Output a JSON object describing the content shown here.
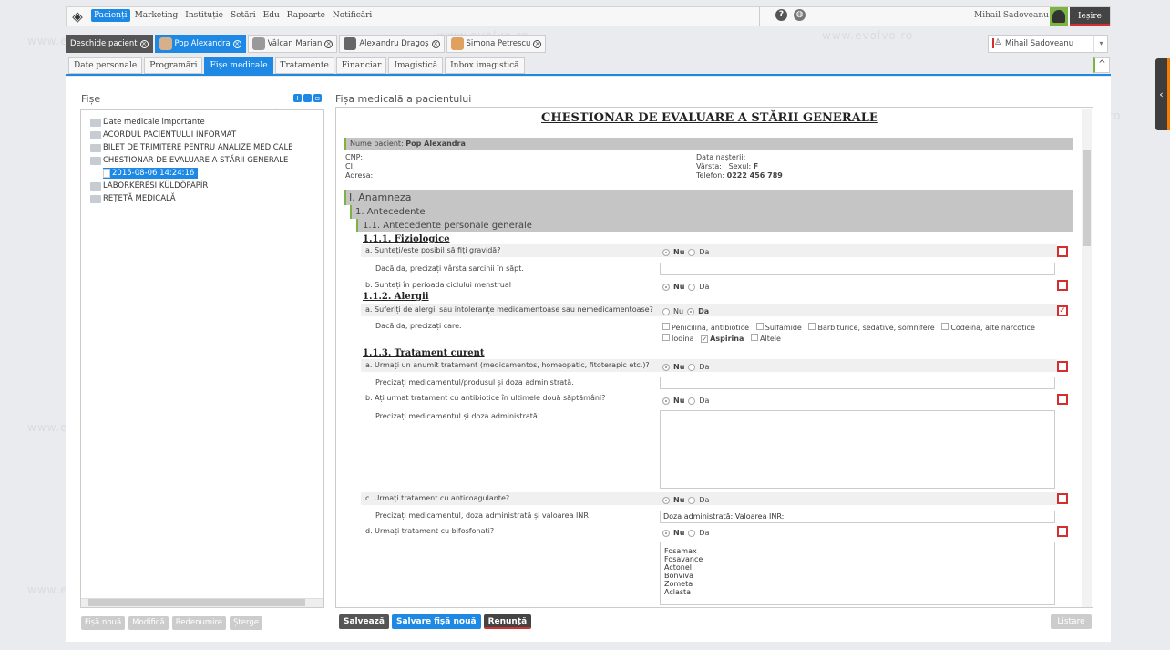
{
  "topnav": {
    "menu": [
      "Pacienți",
      "Marketing",
      "Instituție",
      "Setări",
      "Edu",
      "Rapoarte",
      "Notificări"
    ],
    "active_menu": "Pacienți",
    "user": "Mihail Sadoveanu",
    "logout": "Ieșire"
  },
  "patient_tabs": {
    "open_patient": "Deschide pacient",
    "items": [
      "Pop Alexandra",
      "Vâlcan Marian",
      "Alexandru Dragoș",
      "Simona Petrescu"
    ],
    "doctor": "Mihail Sadoveanu"
  },
  "record_tabs": [
    "Date personale",
    "Programări",
    "Fișe medicale",
    "Tratamente",
    "Financiar",
    "Imagistică",
    "Inbox imagistică"
  ],
  "left": {
    "title": "Fișe",
    "tree": [
      "Date medicale importante",
      "ACORDUL PACIENTULUI INFORMAT",
      "BILET DE TRIMITERE PENTRU ANALIZE MEDICALE",
      "CHESTIONAR DE EVALUARE A STĂRII GENERALE",
      "2015-08-06 14:24:16",
      "LABORKÉRÉSI KÜLDÖPAPÍR",
      "REȚETĂ MEDICALĂ"
    ],
    "buttons": [
      "Fișă nouă",
      "Modifică",
      "Redenumire",
      "Șterge"
    ]
  },
  "form": {
    "header": "Fișa medicală a pacientului",
    "title": "CHESTIONAR DE EVALUARE A STĂRII GENERALE",
    "patient_label": "Nume pacient:",
    "patient_name": "Pop Alexandra",
    "cnp": "CNP:",
    "ci": "CI:",
    "adresa": "Adresa:",
    "birth": "Data nașterii:",
    "age_label": "Vârsta:",
    "sex_label": "Sexul:",
    "sex": "F",
    "phone_label": "Telefon:",
    "phone": "0222 456 789",
    "sec1": "I. Anamneza",
    "sec1_1": "1. Antecedente",
    "sec1_1_1": "1.1. Antecedente personale generale",
    "h_fiz": "1.1.1. Fiziologice",
    "q_a1": "a. Sunteți/este posibil să fiți gravidă?",
    "q_a1_sub": "Dacă da, precizați vârsta sarcinii în săpt.",
    "q_b1": "b. Sunteți în perioada ciclului menstrual",
    "h_alergii": "1.1.2. Alergii",
    "q_a2": "a. Suferiți de alergii sau intoleranțe medicamentoase sau nemedicamentoase?",
    "q_a2_sub": "Dacă da, precizați care.",
    "allergies": [
      "Penicilina, antibiotice",
      "Sulfamide",
      "Barbiturice, sedative, somnifere",
      "Codeina, alte narcotice",
      "Iodina",
      "Aspirina",
      "Altele"
    ],
    "h_trat": "1.1.3. Tratament curent",
    "q_a3": "a. Urmați un anumit tratament (medicamentos, homeopatic, fitoterapic etc.)?",
    "q_a3_sub": "Precizați medicamentul/produsul și doza administrată.",
    "q_b3": "b. Ați urmat tratament cu antibiotice în ultimele două săptămâni?",
    "q_b3_sub": "Precizați medicamentul și doza administrată!",
    "q_c3": "c. Urmați tratament cu anticoagulante?",
    "q_c3_sub": "Precizați medicamentul, doza administrată și valoarea INR!",
    "q_c3_value": "Doza administrată: Valoarea INR:",
    "q_d3": "d. Urmați tratament cu bifosfonați?",
    "bifos": [
      "Fosamax",
      "Fosavance",
      "Actonel",
      "Bonviva",
      "Zometa",
      "Aclasta"
    ],
    "no": "Nu",
    "yes": "Da"
  },
  "bottom": {
    "save": "Salvează",
    "save_new": "Salvare fișă nouă",
    "cancel": "Renunță",
    "list": "Listare"
  },
  "watermark": "www.evolvo.ro"
}
